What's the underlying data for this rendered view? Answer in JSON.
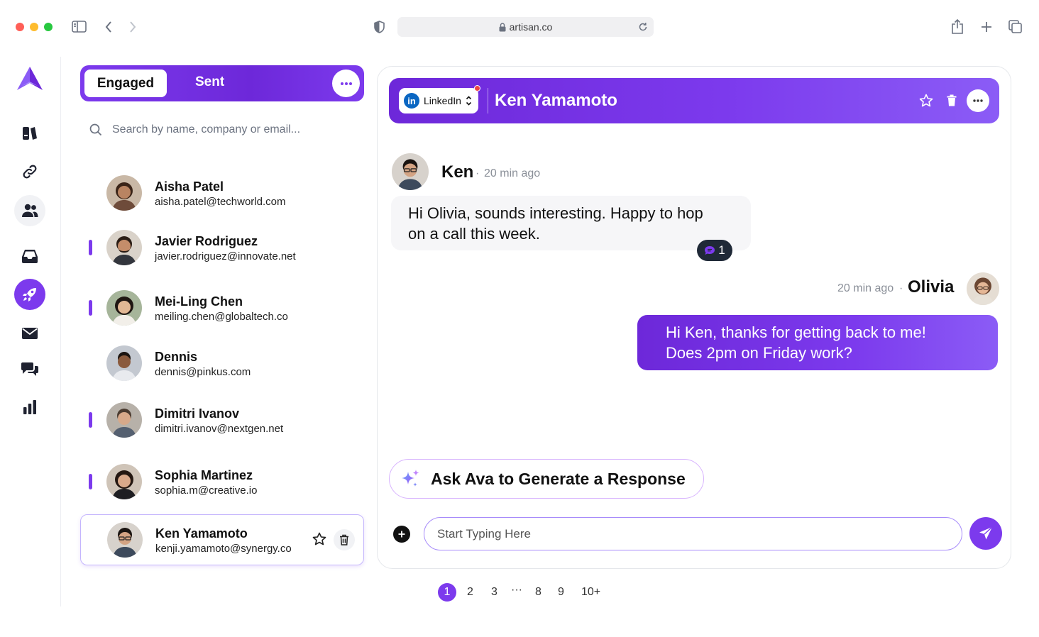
{
  "browser": {
    "traffic_lights": {
      "close": "#ff5f57",
      "minimize": "#febc2e",
      "zoom": "#28c840"
    },
    "url": "artisan.co"
  },
  "theme": {
    "accent": "#7c3aed"
  },
  "rail": {
    "items": [
      {
        "icon": "logo-icon"
      },
      {
        "icon": "book-icon"
      },
      {
        "icon": "link-icon"
      },
      {
        "icon": "users-icon"
      },
      {
        "icon": "inbox-icon"
      },
      {
        "icon": "rocket-icon"
      },
      {
        "icon": "mail-icon"
      },
      {
        "icon": "chat-bubbles-icon"
      },
      {
        "icon": "bar-chart-icon"
      }
    ]
  },
  "tabs": {
    "engaged": "Engaged",
    "sent": "Sent"
  },
  "search": {
    "placeholder": "Search by name, company or email..."
  },
  "contacts": [
    {
      "name": "Aisha Patel",
      "email": "aisha.patel@techworld.com",
      "marked": false
    },
    {
      "name": "Javier Rodriguez",
      "email": "javier.rodriguez@innovate.net",
      "marked": true
    },
    {
      "name": "Mei-Ling Chen",
      "email": "meiling.chen@globaltech.co",
      "marked": true
    },
    {
      "name": "Dennis",
      "email": "dennis@pinkus.com",
      "marked": false
    },
    {
      "name": "Dimitri Ivanov",
      "email": "dimitri.ivanov@nextgen.net",
      "marked": true
    },
    {
      "name": "Sophia Martinez",
      "email": "sophia.m@creative.io",
      "marked": true
    },
    {
      "name": "Ken Yamamoto",
      "email": "kenji.yamamoto@synergy.co",
      "marked": false,
      "selected": true
    }
  ],
  "conversation": {
    "channel": "LinkedIn",
    "contact_name": "Ken Yamamoto",
    "messages": [
      {
        "sender": "Ken",
        "time": "20 min ago",
        "text_line1": "Hi Olivia, sounds interesting. Happy to hop",
        "text_line2": "on a call this week.",
        "reaction_count": "1"
      },
      {
        "sender": "Olivia",
        "time": "20 min ago",
        "text_line1": "Hi Ken, thanks for getting back to me!",
        "text_line2": "Does 2pm on Friday work?"
      }
    ],
    "ai_button": "Ask Ava to Generate a Response",
    "composer_placeholder": "Start Typing Here"
  },
  "pagination": {
    "pages": [
      "1",
      "2",
      "3",
      "···",
      "8",
      "9",
      "10+"
    ],
    "current": "1"
  }
}
